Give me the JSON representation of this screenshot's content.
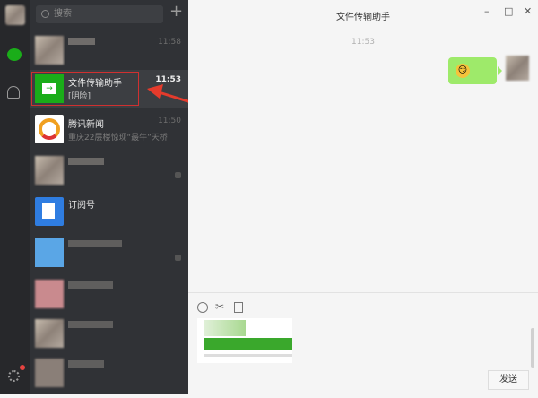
{
  "search": {
    "placeholder": "搜索",
    "add_label": "+"
  },
  "chats": [
    {
      "name": "",
      "preview": "",
      "time": "11:58"
    },
    {
      "name": "文件传输助手",
      "preview": "[阴险]",
      "time": "11:53"
    },
    {
      "name": "腾讯新闻",
      "preview": "重庆22层楼惊现“最牛”天桥",
      "time": "11:50"
    },
    {
      "name": "",
      "preview": "",
      "time": ""
    },
    {
      "name": "订阅号",
      "preview": "",
      "time": ""
    },
    {
      "name": "",
      "preview": "",
      "time": ""
    },
    {
      "name": "",
      "preview": "",
      "time": ""
    },
    {
      "name": "",
      "preview": "",
      "time": ""
    },
    {
      "name": "",
      "preview": "",
      "time": ""
    }
  ],
  "chat": {
    "title": "文件传输助手",
    "timestamp": "11:53",
    "send_label": "发送"
  },
  "window": {
    "minimize": "–",
    "maximize": "□",
    "close": "✕"
  },
  "colors": {
    "accent": "#1aad19",
    "bubble": "#9eea6a"
  }
}
